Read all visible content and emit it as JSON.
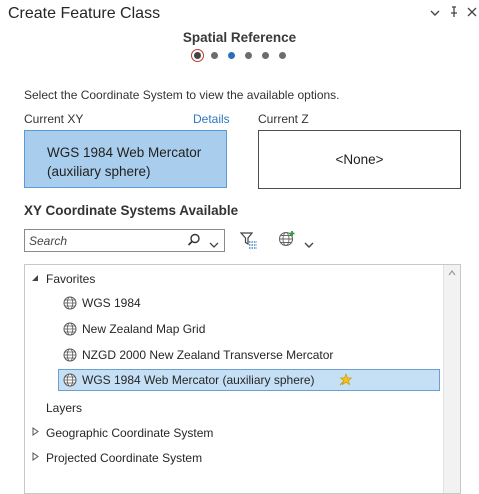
{
  "window": {
    "title": "Create Feature Class",
    "controls": {
      "menu": "⌄",
      "pin": "⊥",
      "close": "✕"
    }
  },
  "wizard": {
    "step_label": "Spatial Reference",
    "steps_total": 6,
    "current_step": 1,
    "active_step": 3
  },
  "instructions": "Select the Coordinate System to view the available options.",
  "current_xy": {
    "label": "Current XY",
    "details_link": "Details",
    "value_line1": "WGS 1984 Web Mercator",
    "value_line2": "(auxiliary sphere)"
  },
  "current_z": {
    "label": "Current Z",
    "value": "<None>"
  },
  "available": {
    "heading": "XY Coordinate Systems Available",
    "search_placeholder": "Search",
    "search_icon": "search-icon",
    "filter_icon": "filter-icon",
    "add_icon": "add-globe-icon"
  },
  "tree": {
    "favorites": {
      "label": "Favorites",
      "items": [
        "WGS 1984",
        "New Zealand Map Grid",
        "NZGD 2000 New Zealand Transverse Mercator",
        "WGS 1984 Web Mercator (auxiliary sphere)"
      ]
    },
    "layers_label": "Layers",
    "geographic_label": "Geographic Coordinate System",
    "projected_label": "Projected Coordinate System"
  },
  "colors": {
    "accent": "#2b6fb8",
    "selected_bg": "#a9cdec",
    "selected_border": "#5b9bd5",
    "link": "#2b79c2"
  }
}
